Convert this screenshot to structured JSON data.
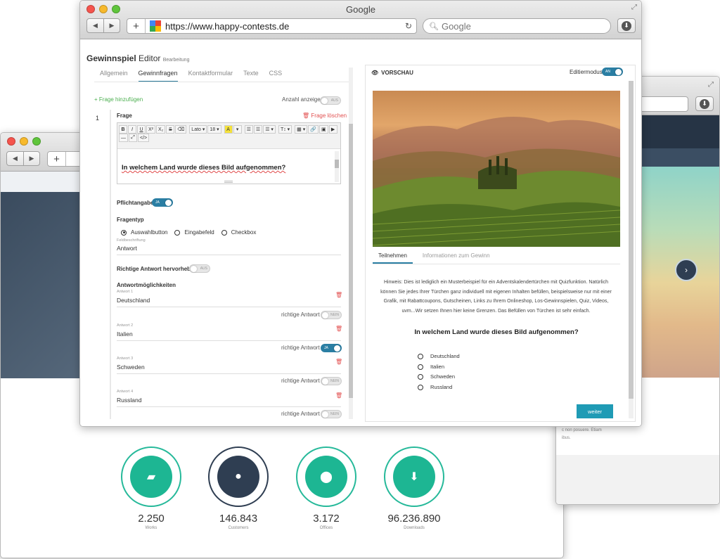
{
  "window_main": {
    "title": "Google",
    "url": "https://www.happy-contests.de",
    "search_placeholder": "Google"
  },
  "editor": {
    "title_bold": "Gewinnspiel",
    "title_rest": " Editor",
    "title_sub": "Bearbeitung",
    "tabs": [
      "Allgemein",
      "Gewinnfragen",
      "Kontaktformular",
      "Texte",
      "CSS"
    ],
    "add_question": "+ Frage hinzufügen",
    "show_count_label": "Anzahl anzeigen",
    "toggle_off": "AUS",
    "toggle_on": "JA",
    "toggle_nein": "NEIN",
    "question_number": "1",
    "question_label": "Frage",
    "delete_question": "Frage löschen",
    "toolbar": [
      "B",
      "I",
      "U",
      "X²",
      "X₂",
      "S",
      "⌫",
      "Lato ▾",
      "18 ▾",
      "A",
      "▾",
      "☰",
      "☰",
      "☰ ▾",
      "T↕ ▾",
      "▦ ▾",
      "🔗",
      "▣",
      "▶",
      "—",
      "⤢",
      "</>"
    ],
    "question_text": "In welchem Land wurde dieses Bild aufgenommen?",
    "required_label": "Pflichtangabe",
    "type_label": "Fragentyp",
    "type_options": [
      "Auswahlbutton",
      "Eingabefeld",
      "Checkbox"
    ],
    "field_label_small": "Feldbeschriftung",
    "field_label_value": "Antwort",
    "highlight_label": "Richtige Antwort hervorheben",
    "answers_label": "Antwortmöglichkeiten",
    "correct_label": "richtige Antwort",
    "answers": [
      {
        "small": "Antwort 1",
        "value": "Deutschland",
        "correct": "NEIN"
      },
      {
        "small": "Antwort 2",
        "value": "Italien",
        "correct": "JA"
      },
      {
        "small": "Antwort 3",
        "value": "Schweden",
        "correct": "NEIN"
      },
      {
        "small": "Antwort 4",
        "value": "Russland",
        "correct": "NEIN"
      }
    ]
  },
  "preview": {
    "title": "VORSCHAU",
    "edit_mode_label": "Editiermodus",
    "edit_mode_toggle": "AN",
    "tabs": [
      "Teilnehmen",
      "Informationen zum Gewinn"
    ],
    "hint": "Hinweis: Dies ist lediglich ein Musterbeispiel für ein Adventskalendertürchen mit Quizfunktion. Natürlich können Sie jedes Ihrer Türchen ganz individuell mit eigenen Inhalten befüllen, beispielsweise nur mit einer Grafik, mit Rabattcoupons, Gutscheinen, Links zu Ihrem Onlineshop, Los-Gewinnspielen, Quiz, Videos, uvm...Wir setzen Ihnen hier keine Grenzen. Das Befüllen von Türchen ist sehr einfach.",
    "question": "In welchem Land wurde dieses Bild aufgenommen?",
    "options": [
      "Deutschland",
      "Italien",
      "Schweden",
      "Russland"
    ],
    "next_button": "weiter"
  },
  "back_left": {
    "stats": [
      {
        "value": "2.250",
        "label": "Works",
        "icon": "briefcase-icon"
      },
      {
        "value": "146.843",
        "label": "Customers",
        "icon": "user-icon"
      },
      {
        "value": "3.172",
        "label": "Offices",
        "icon": "location-pin-icon"
      },
      {
        "value": "96.236.890",
        "label": "Downloads",
        "icon": "download-icon"
      }
    ]
  },
  "back_right": {
    "footer_text_1": "c non posuere. Etiam",
    "footer_text_2": "ibus."
  },
  "colors": {
    "accent": "#2a7ea3",
    "green": "#1db693",
    "dark_navy": "#2f3e52",
    "teal_button": "#1f9bb5"
  }
}
